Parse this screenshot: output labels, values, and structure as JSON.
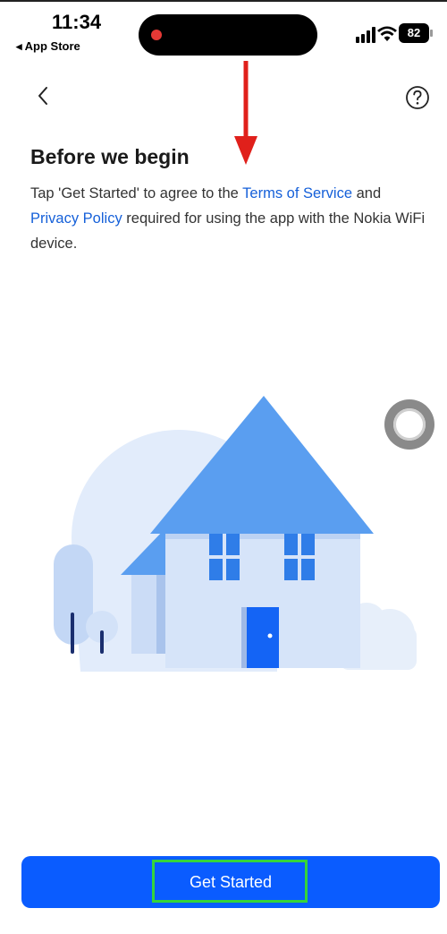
{
  "status_bar": {
    "time": "11:34",
    "back_label": "◂ App Store",
    "battery": "82"
  },
  "nav": {
    "back_icon": "chevron-left-icon",
    "help_icon": "question-circle-icon"
  },
  "content": {
    "heading": "Before we begin",
    "desc_part1": "Tap 'Get Started' to agree to the ",
    "terms_link": "Terms of Service",
    "desc_part2": " and ",
    "privacy_link": "Privacy Policy",
    "desc_part3": " required for using the app with the Nokia WiFi device."
  },
  "footer": {
    "button_label": "Get Started"
  },
  "colors": {
    "accent": "#0a5cff",
    "link": "#1560d9",
    "annotation_arrow": "#e0201b",
    "annotation_highlight": "#35d43a"
  }
}
